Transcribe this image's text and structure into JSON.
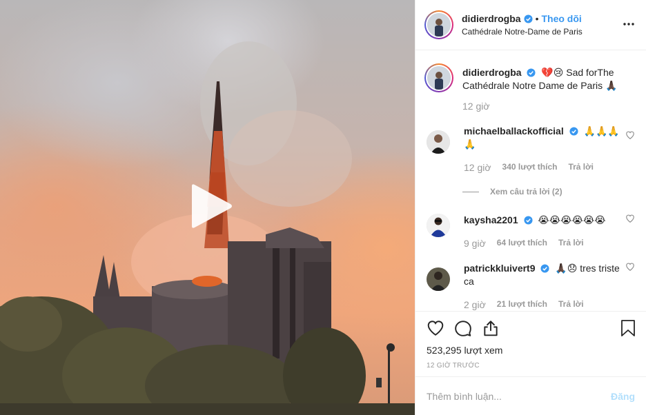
{
  "post": {
    "username": "didierdrogba",
    "follow_label": "Theo dõi",
    "separator": "•",
    "location": "Cathédrale Notre-Dame de Paris",
    "caption_text": "💔😢 Sad forThe Cathédrale Notre Dame de Paris 🙏🏿",
    "caption_time": "12 giờ",
    "views": "523,295 lượt xem",
    "time_ago": "12 GIỜ TRƯỚC"
  },
  "comments": [
    {
      "username": "michaelballackofficial",
      "text": "🙏🙏🙏🙏",
      "time": "12 giờ",
      "likes": "340 lượt thích",
      "reply_label": "Trả lời",
      "view_replies": "Xem câu trả lời (2)"
    },
    {
      "username": "kaysha2201",
      "text": "😭😭😭😭😭😭",
      "time": "9 giờ",
      "likes": "64 lượt thích",
      "reply_label": "Trả lời"
    },
    {
      "username": "patrickkluivert9",
      "text": "🙏🏿😞 tres triste ca",
      "time": "2 giờ",
      "likes": "21 lượt thích",
      "reply_label": "Trả lời"
    }
  ],
  "composer": {
    "placeholder": "Thêm bình luận...",
    "post_label": "Đăng"
  },
  "colors": {
    "accent": "#3897f0",
    "post_disabled": "#b2dffc",
    "muted": "#999999"
  },
  "icons": {
    "play": "play-icon",
    "more": "more-options-icon",
    "like": "heart-icon",
    "comment": "comment-icon",
    "share": "share-icon",
    "save": "bookmark-icon"
  }
}
